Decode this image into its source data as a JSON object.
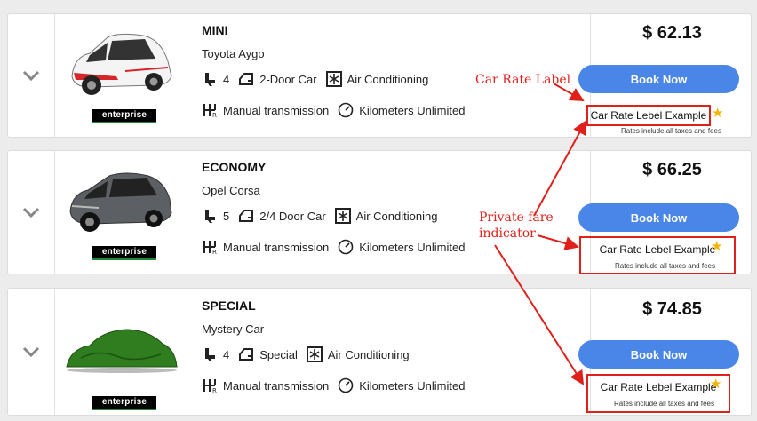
{
  "book_label": "Book Now",
  "rate_label": "Car Rate Lebel Example",
  "fees_note": "Rates include all taxes and fees",
  "vendor": "enterprise",
  "accent_color": "#4a86e8",
  "annotation_color": "#e0201b",
  "annotations": {
    "rate_label": "Car Rate Label",
    "private_fare": "Private fare indicator"
  },
  "cars": [
    {
      "category": "MINI",
      "model": "Toyota Aygo",
      "seats": "4",
      "doors": "2-Door Car",
      "ac": "Air Conditioning",
      "transmission": "Manual transmission",
      "mileage": "Kilometers Unlimited",
      "price": "$ 62.13",
      "image": "white-red-hatchback"
    },
    {
      "category": "ECONOMY",
      "model": "Opel Corsa",
      "seats": "5",
      "doors": "2/4 Door Car",
      "ac": "Air Conditioning",
      "transmission": "Manual transmission",
      "mileage": "Kilometers Unlimited",
      "price": "$ 66.25",
      "image": "grey-hatchback"
    },
    {
      "category": "SPECIAL",
      "model": "Mystery Car",
      "seats": "4",
      "doors": "Special",
      "ac": "Air Conditioning",
      "transmission": "Manual transmission",
      "mileage": "Kilometers Unlimited",
      "price": "$ 74.85",
      "image": "covered-car"
    }
  ]
}
